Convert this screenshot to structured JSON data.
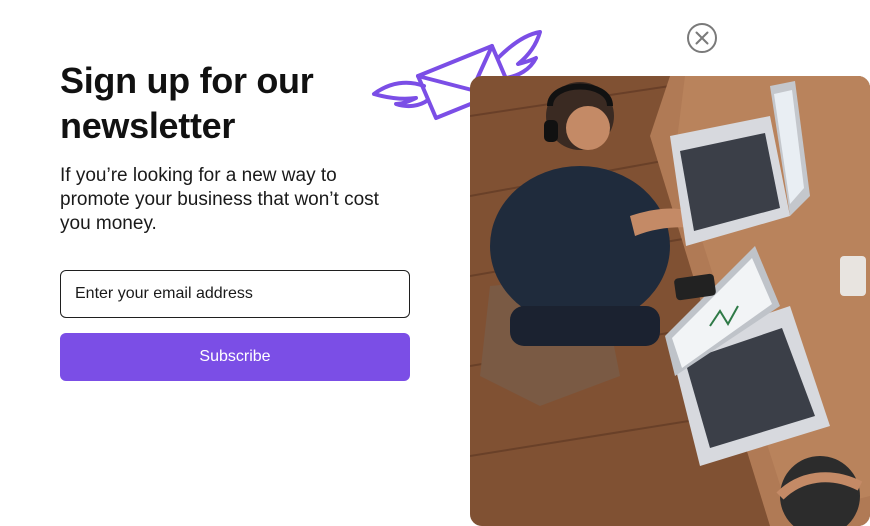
{
  "newsletter": {
    "headline": "Sign up for our newsletter",
    "subtext": "If you’re looking for a new way to promote your business that won’t cost you money.",
    "email_placeholder": "Enter your email address",
    "subscribe_label": "Subscribe"
  },
  "icons": {
    "close": "close-circle-icon",
    "envelope": "winged-envelope-icon"
  },
  "colors": {
    "accent": "#7b4ee6",
    "text": "#111111",
    "input_border": "#1f1f1f"
  }
}
